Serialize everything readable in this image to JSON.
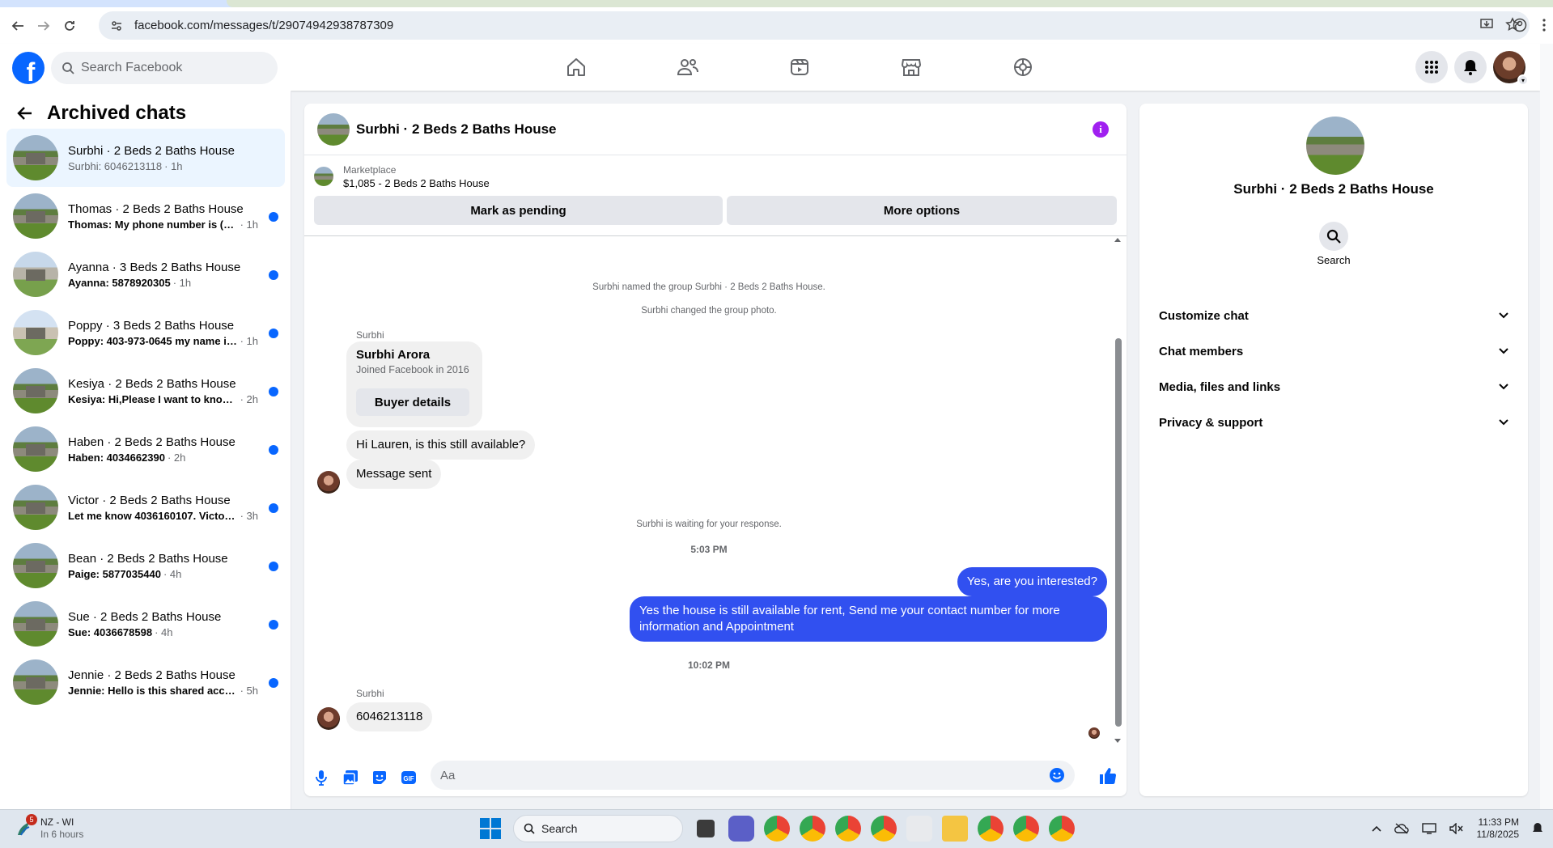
{
  "browser": {
    "url": "facebook.com/messages/t/29074942938787309"
  },
  "fb": {
    "search_placeholder": "Search Facebook"
  },
  "sidebar": {
    "title": "Archived chats",
    "chats": [
      {
        "name": "Surbhi · 2 Beds 2 Baths House",
        "preview": "Surbhi: 6046213118",
        "time": "· 1h",
        "unread": false,
        "active": true
      },
      {
        "name": "Thomas · 2 Beds 2 Baths House",
        "preview": "Thomas: My phone number is (204...",
        "time": "· 1h",
        "unread": true,
        "active": false
      },
      {
        "name": "Ayanna · 3 Beds 2 Baths House",
        "preview": "Ayanna: 5878920305",
        "time": "· 1h",
        "unread": true,
        "active": false
      },
      {
        "name": "Poppy · 3 Beds 2 Baths House",
        "preview": "Poppy: 403-973-0645 my name is ...",
        "time": "· 1h",
        "unread": true,
        "active": false
      },
      {
        "name": "Kesiya · 2 Beds 2 Baths House",
        "preview": "Kesiya: Hi,Please I want to know m...",
        "time": "· 2h",
        "unread": true,
        "active": false
      },
      {
        "name": "Haben · 2 Beds 2 Baths House",
        "preview": "Haben: 4034662390",
        "time": "· 2h",
        "unread": true,
        "active": false
      },
      {
        "name": "Victor · 2 Beds 2 Baths House",
        "preview": "Let me know 4036160107. Victor. T...",
        "time": "· 3h",
        "unread": true,
        "active": false
      },
      {
        "name": "Bean · 2 Beds 2 Baths House",
        "preview": "Paige: 5877035440",
        "time": "· 4h",
        "unread": true,
        "active": false
      },
      {
        "name": "Sue · 2 Beds 2 Baths House",
        "preview": "Sue: 4036678598",
        "time": "· 4h",
        "unread": true,
        "active": false
      },
      {
        "name": "Jennie · 2 Beds 2 Baths House",
        "preview": "Jennie: Hello is this shared accom...",
        "time": "· 5h",
        "unread": true,
        "active": false
      }
    ]
  },
  "chat": {
    "title": "Surbhi · 2 Beds 2 Baths House",
    "marketplace_label": "Marketplace",
    "listing": "$1,085 - 2 Beds 2 Baths House",
    "mark_pending": "Mark as pending",
    "more_options": "More options",
    "system_1": "Surbhi named the group Surbhi · 2 Beds 2 Baths House.",
    "system_2": "Surbhi changed the group photo.",
    "sender_1": "Surbhi",
    "card_name": "Surbhi Arora",
    "card_joined": "Joined Facebook in 2016",
    "card_button": "Buyer details",
    "msg_1": "Hi Lauren, is this still available?",
    "msg_2": "Message sent",
    "system_3": "Surbhi is waiting for your response.",
    "time_1": "5:03 PM",
    "out_1": "Yes, are you interested?",
    "out_2": "Yes the house is still available for rent, Send me your contact number for more information and Appointment",
    "time_2": "10:02 PM",
    "sender_2": "Surbhi",
    "msg_3": "6046213118",
    "composer_placeholder": "Aa"
  },
  "info": {
    "title": "Surbhi · 2 Beds 2 Baths House",
    "search_label": "Search",
    "sections": [
      "Customize chat",
      "Chat members",
      "Media, files and links",
      "Privacy & support"
    ]
  },
  "taskbar": {
    "weather_title": "NZ - WI",
    "weather_sub": "In 6 hours",
    "weather_badge": "5",
    "search": "Search",
    "time": "11:33 PM",
    "date": "11/8/2025"
  },
  "colors": {
    "brand": "#0866ff",
    "outgoing": "#3150f0",
    "info_icon": "#a020f0"
  }
}
